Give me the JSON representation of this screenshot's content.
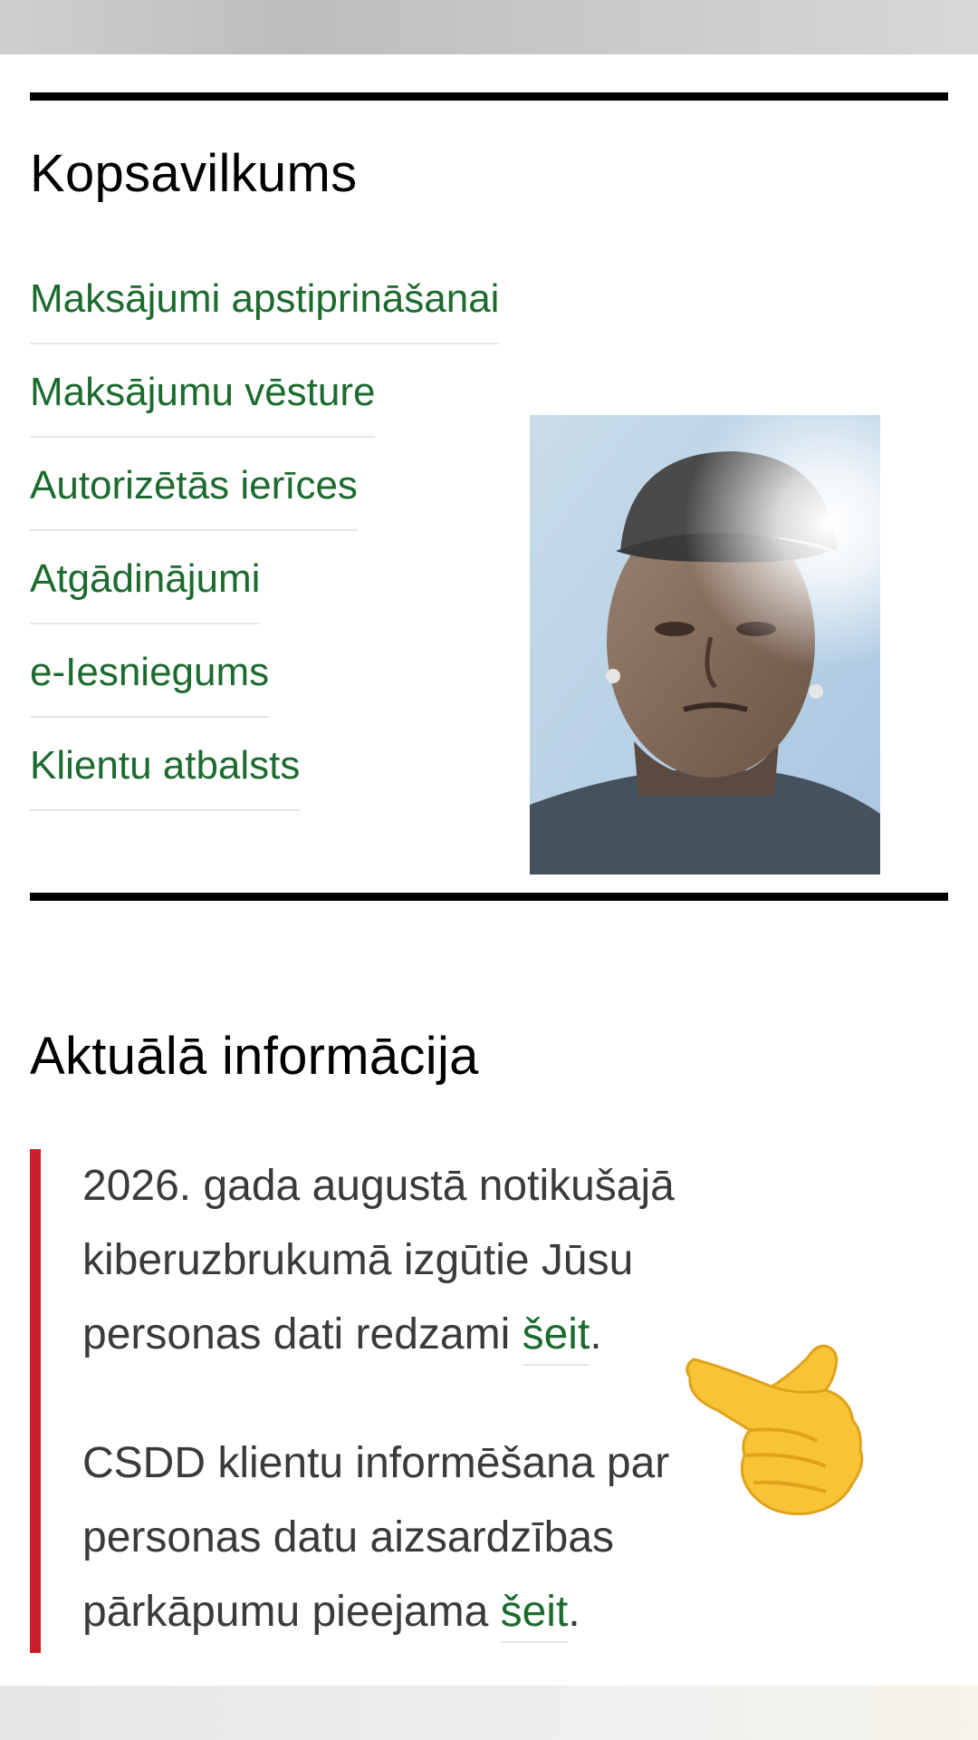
{
  "summary": {
    "title": "Kopsavilkums",
    "links": [
      {
        "label": "Maksājumi apstiprināšanai"
      },
      {
        "label": "Maksājumu vēsture"
      },
      {
        "label": "Autorizētās ierīces"
      },
      {
        "label": "Atgādinājumi"
      },
      {
        "label": "e-Iesniegums"
      },
      {
        "label": "Klientu atbalsts"
      }
    ]
  },
  "news": {
    "title": "Aktuālā informācija",
    "paragraph1": {
      "text": "2026. gada augustā notikušajā kiberuzbrukumā izgūtie Jūsu personas dati redzami ",
      "link": "šeit",
      "end": "."
    },
    "paragraph2": {
      "text": "CSDD klientu informēšana par personas datu aizsardzības pārkāpumu pieejama ",
      "link": "šeit",
      "end": "."
    }
  },
  "colors": {
    "link": "#1b6b2e",
    "accent_bar": "#cc1f2c",
    "rule": "#000000"
  },
  "icons": {
    "pointer": "backhand-index-pointing-right-icon"
  }
}
